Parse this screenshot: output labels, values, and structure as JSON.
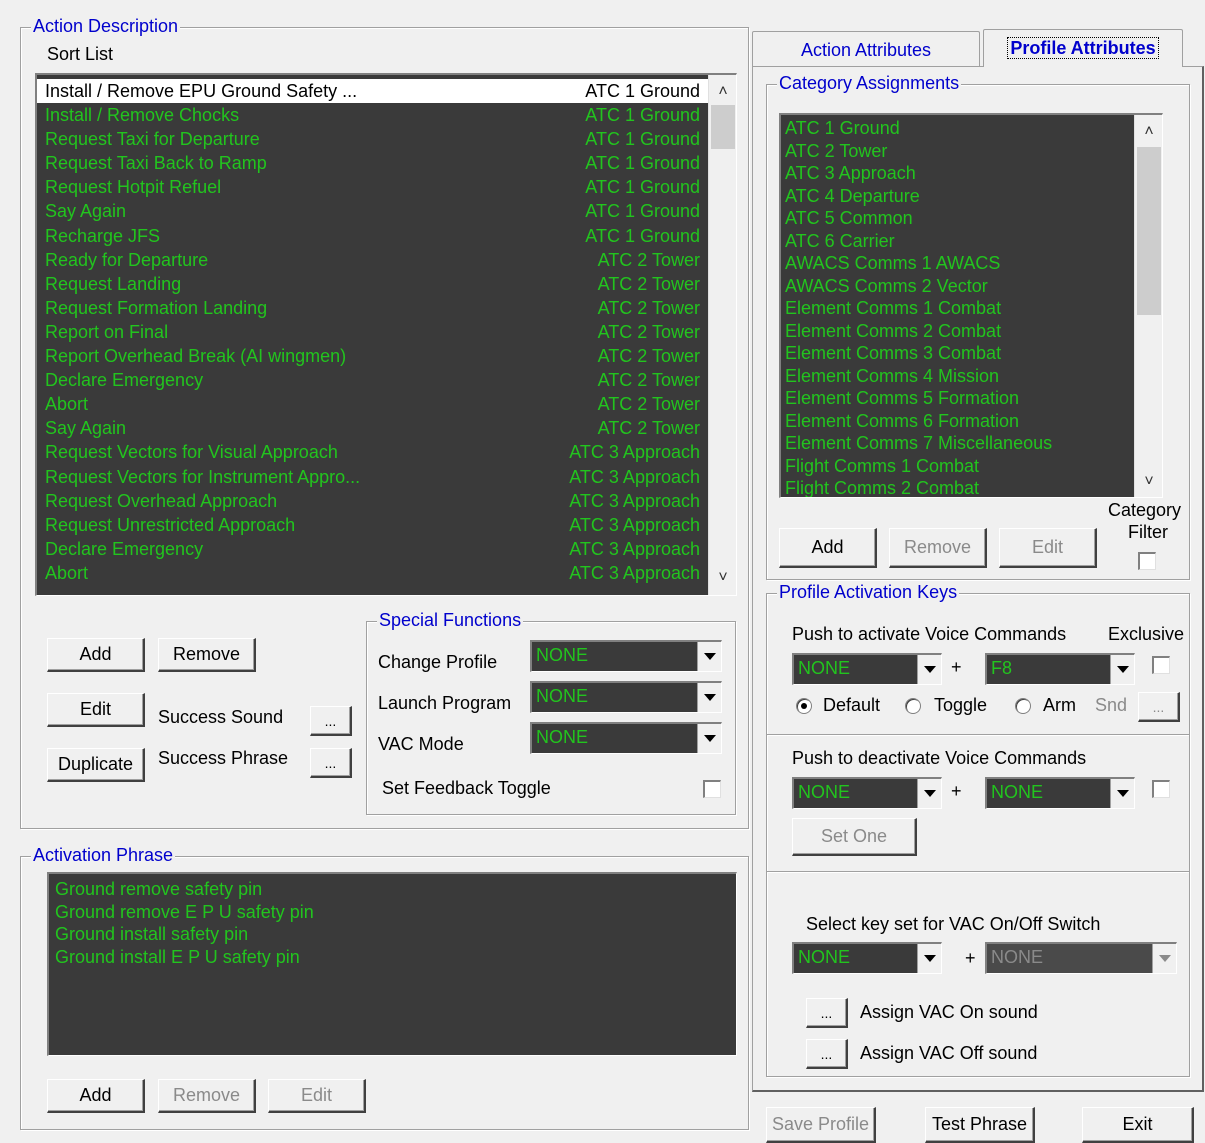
{
  "action_description": {
    "legend": "Action Description",
    "sort_list_label": "Sort List",
    "rows": [
      {
        "name": "Install / Remove EPU Ground Safety ...",
        "category": "ATC 1 Ground",
        "selected": true
      },
      {
        "name": "Install / Remove Chocks",
        "category": "ATC 1 Ground"
      },
      {
        "name": "Request Taxi for Departure",
        "category": "ATC 1 Ground"
      },
      {
        "name": "Request Taxi Back to Ramp",
        "category": "ATC 1 Ground"
      },
      {
        "name": "Request Hotpit Refuel",
        "category": "ATC 1 Ground"
      },
      {
        "name": "Say Again",
        "category": "ATC 1 Ground"
      },
      {
        "name": "Recharge JFS",
        "category": "ATC 1 Ground"
      },
      {
        "name": "Ready for Departure",
        "category": "ATC 2 Tower"
      },
      {
        "name": "Request Landing",
        "category": "ATC 2 Tower"
      },
      {
        "name": "Request Formation Landing",
        "category": "ATC 2 Tower"
      },
      {
        "name": "Report on Final",
        "category": "ATC 2 Tower"
      },
      {
        "name": "Report Overhead Break (AI wingmen)",
        "category": "ATC 2 Tower"
      },
      {
        "name": "Declare Emergency",
        "category": "ATC 2 Tower"
      },
      {
        "name": "Abort",
        "category": "ATC 2 Tower"
      },
      {
        "name": "Say Again",
        "category": "ATC 2 Tower"
      },
      {
        "name": "Request Vectors for Visual Approach",
        "category": "ATC 3 Approach"
      },
      {
        "name": "Request Vectors for Instrument Appro...",
        "category": "ATC 3 Approach"
      },
      {
        "name": "Request Overhead Approach",
        "category": "ATC 3 Approach"
      },
      {
        "name": "Request Unrestricted Approach",
        "category": "ATC 3 Approach"
      },
      {
        "name": "Declare Emergency",
        "category": "ATC 3 Approach"
      },
      {
        "name": "Abort",
        "category": "ATC 3 Approach"
      }
    ],
    "buttons": {
      "add": "Add",
      "remove": "Remove",
      "edit": "Edit",
      "duplicate": "Duplicate",
      "browse": "..."
    },
    "success_sound_label": "Success Sound",
    "success_phrase_label": "Success Phrase"
  },
  "special_functions": {
    "legend": "Special Functions",
    "change_profile_label": "Change Profile",
    "change_profile_value": "NONE",
    "launch_program_label": "Launch Program",
    "launch_program_value": "NONE",
    "vac_mode_label": "VAC Mode",
    "vac_mode_value": "NONE",
    "set_feedback_toggle_label": "Set Feedback Toggle"
  },
  "activation_phrase": {
    "legend": "Activation Phrase",
    "phrases": [
      "Ground remove safety pin",
      "Ground remove E P U safety pin",
      "Ground install safety pin",
      "Ground install E P U safety pin"
    ],
    "buttons": {
      "add": "Add",
      "remove": "Remove",
      "edit": "Edit"
    }
  },
  "tabs": {
    "action_attributes": "Action Attributes",
    "profile_attributes": "Profile Attributes"
  },
  "category_assignments": {
    "legend": "Category Assignments",
    "items": [
      "ATC 1 Ground",
      "ATC 2 Tower",
      "ATC 3 Approach",
      "ATC 4 Departure",
      "ATC 5 Common",
      "ATC 6 Carrier",
      "AWACS Comms 1 AWACS",
      "AWACS Comms 2 Vector",
      "Element Comms 1 Combat",
      "Element Comms 2 Combat",
      "Element Comms 3 Combat",
      "Element Comms 4 Mission",
      "Element Comms 5 Formation",
      "Element Comms 6 Formation",
      "Element Comms 7 Miscellaneous",
      "Flight Comms 1 Combat",
      "Flight Comms 2 Combat"
    ],
    "buttons": {
      "add": "Add",
      "remove": "Remove",
      "edit": "Edit"
    },
    "category_filter_line1": "Category",
    "category_filter_line2": "Filter"
  },
  "profile_activation_keys": {
    "legend": "Profile Activation Keys",
    "push_to_activate_label": "Push to activate Voice Commands",
    "exclusive_label": "Exclusive",
    "activate_key1": "NONE",
    "activate_key2": "F8",
    "plus": "+",
    "radio_default": "Default",
    "radio_toggle": "Toggle",
    "radio_arm": "Arm",
    "snd_label": "Snd",
    "browse": "...",
    "push_to_deactivate_label": "Push to deactivate Voice Commands",
    "deactivate_key1": "NONE",
    "deactivate_key2": "NONE",
    "set_one": "Set One",
    "vac_switch_label": "Select key set for VAC On/Off Switch",
    "vac_key1": "NONE",
    "vac_key2": "NONE",
    "assign_vac_on": "Assign VAC On sound",
    "assign_vac_off": "Assign VAC Off sound"
  },
  "bottom_buttons": {
    "save_profile": "Save Profile",
    "test_phrase": "Test Phrase",
    "exit": "Exit"
  }
}
